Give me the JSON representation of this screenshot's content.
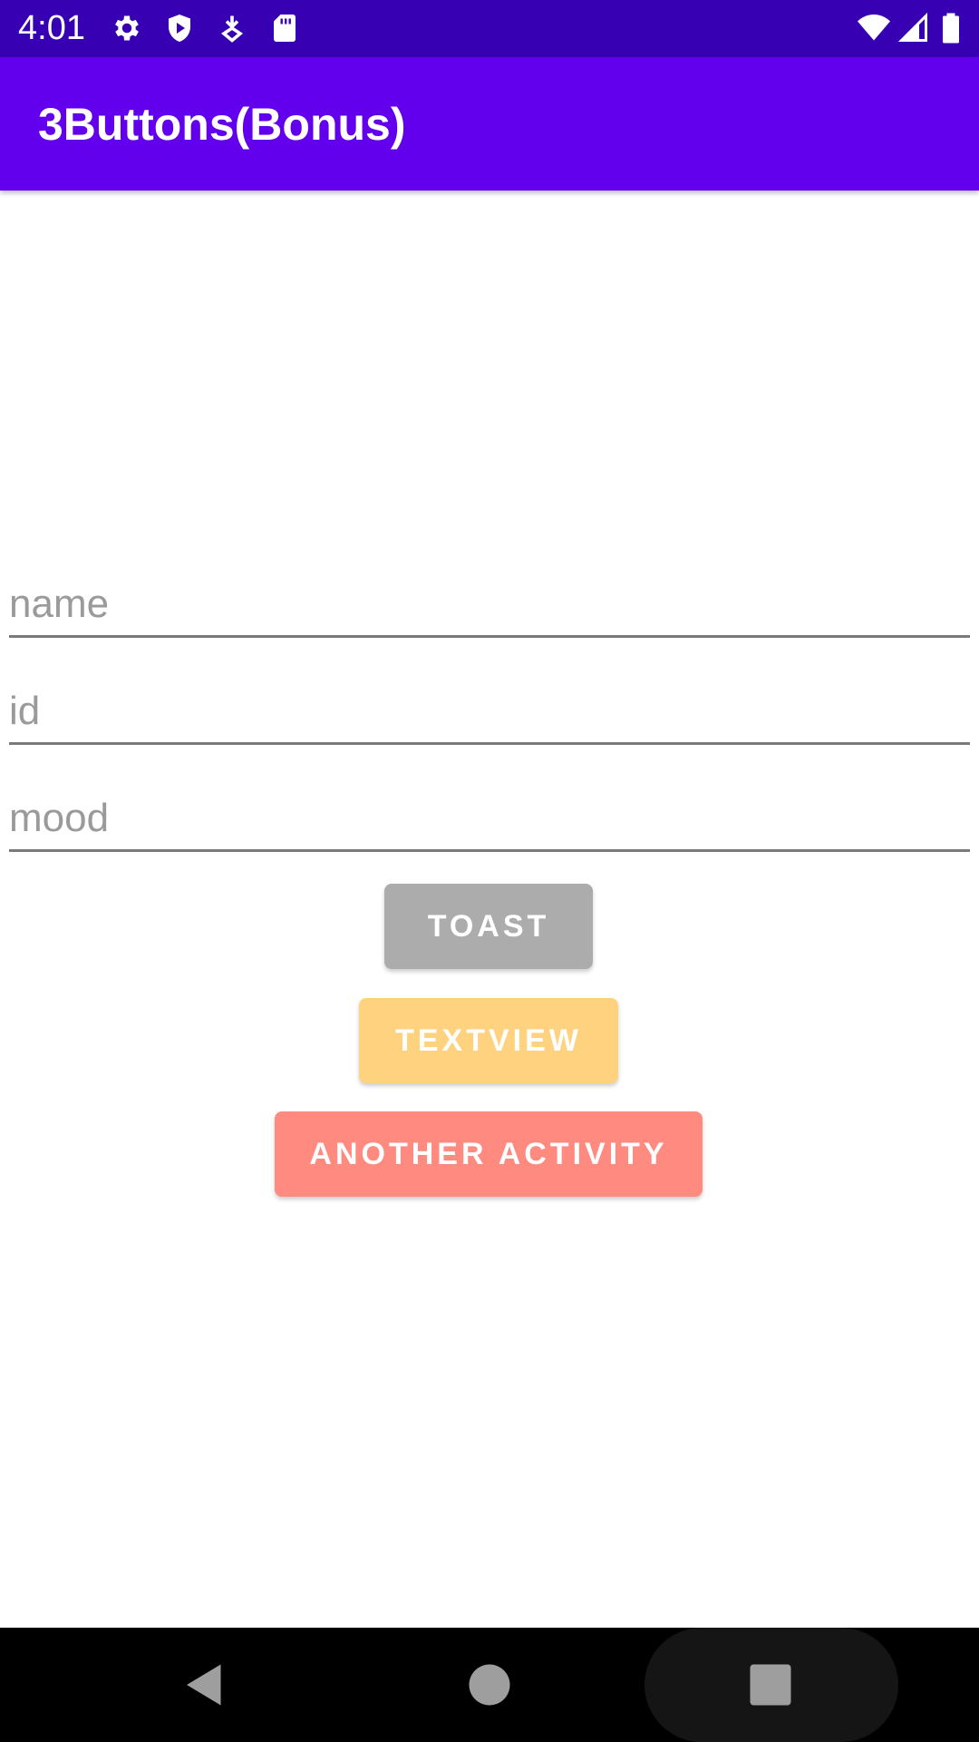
{
  "status_bar": {
    "time": "4:01",
    "icons": [
      "gear-icon",
      "shield-icon",
      "download-icon",
      "sd-card-icon",
      "wifi-icon",
      "signal-icon",
      "battery-icon"
    ],
    "background": "#3700b3"
  },
  "app_bar": {
    "title": "3Buttons(Bonus)",
    "background": "#6200ee"
  },
  "form": {
    "name_placeholder": "name",
    "id_placeholder": "id",
    "mood_placeholder": "mood"
  },
  "buttons": {
    "toast_label": "TOAST",
    "toast_color": "#acacac",
    "textview_label": "TEXTVIEW",
    "textview_color": "#ffd27f",
    "activity_label": "ANOTHER ACTIVITY",
    "activity_color": "#ff8a80"
  },
  "nav_bar": {
    "icons": [
      "back-icon",
      "home-icon",
      "recents-icon"
    ]
  }
}
